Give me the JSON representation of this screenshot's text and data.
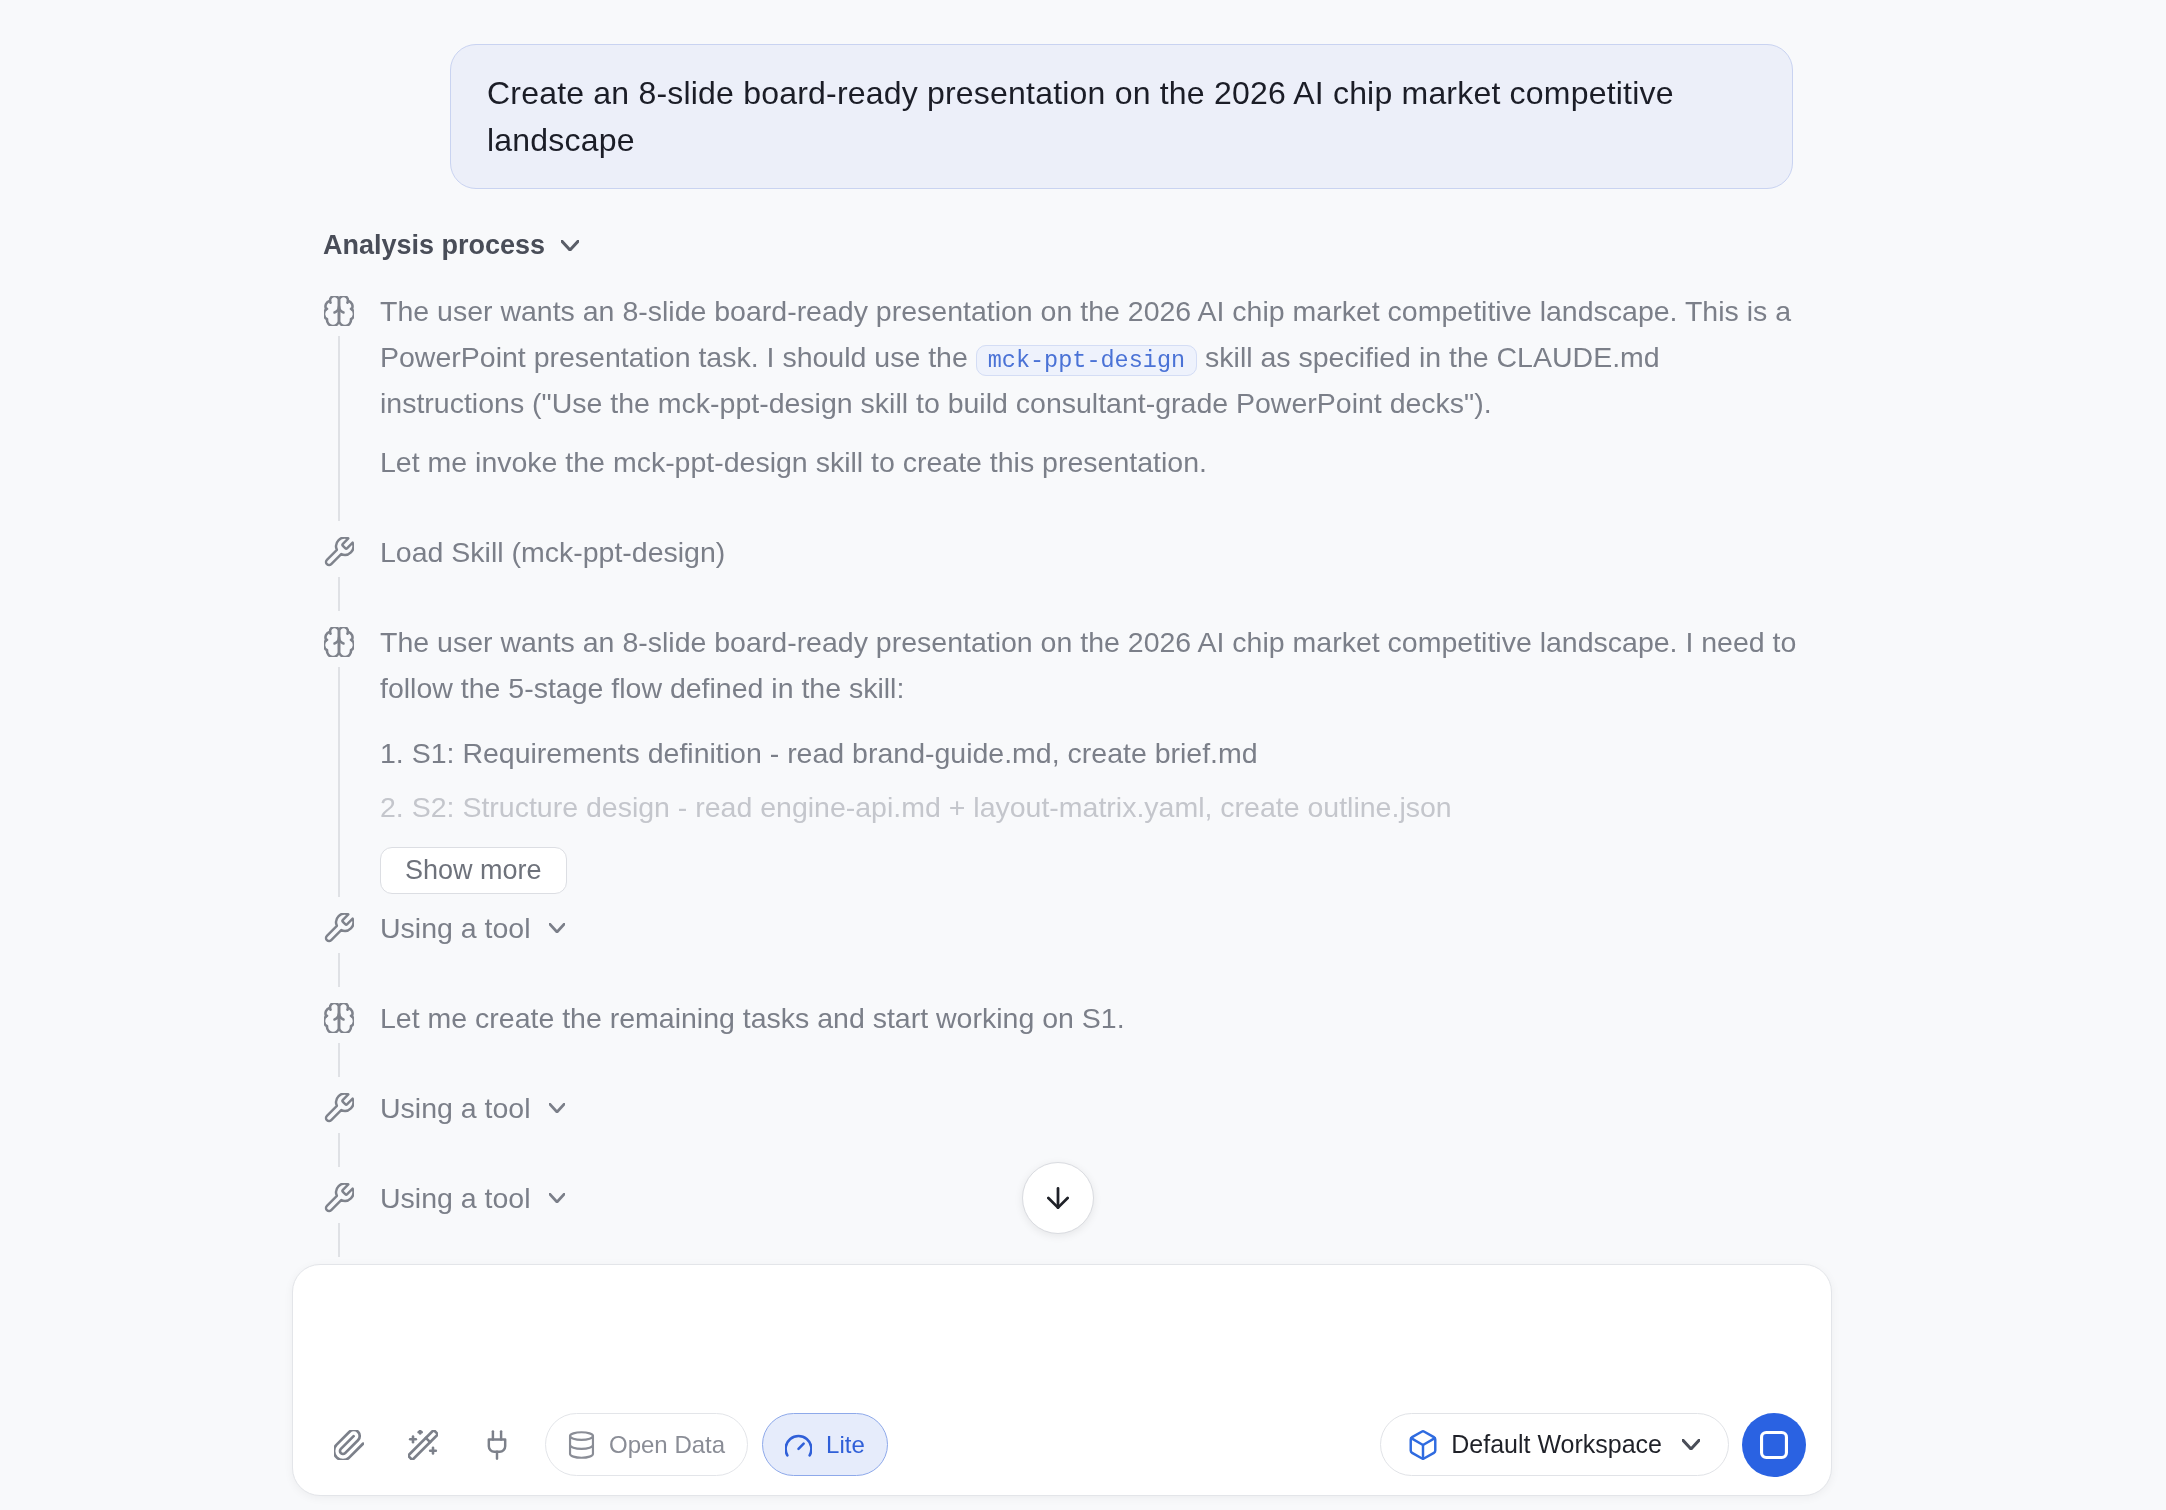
{
  "user_message": {
    "text": "Create an 8-slide board-ready presentation on the 2026 AI chip market competitive landscape"
  },
  "analysis": {
    "title": "Analysis process",
    "expanded": true,
    "steps": [
      {
        "kind": "thought",
        "paragraphs": [
          {
            "parts": [
              {
                "kind": "text",
                "text": "The user wants an 8-slide board-ready presentation on the 2026 AI chip market competitive landscape. This is a PowerPoint presentation task. I should use the "
              },
              {
                "kind": "code",
                "text": "mck-ppt-design"
              },
              {
                "kind": "text",
                "text": " skill as specified in the CLAUDE.md instructions (\"Use the mck-ppt-design skill to build consultant-grade PowerPoint decks\")."
              }
            ]
          },
          {
            "parts": [
              {
                "kind": "text",
                "text": "Let me invoke the mck-ppt-design skill to create this presentation."
              }
            ]
          }
        ]
      },
      {
        "kind": "tool",
        "label": "Load Skill (mck-ppt-design)",
        "collapsible": false
      },
      {
        "kind": "thought",
        "paragraphs": [
          {
            "parts": [
              {
                "kind": "text",
                "text": "The user wants an 8-slide board-ready presentation on the 2026 AI chip market competitive landscape. I need to follow the 5-stage flow defined in the skill:"
              }
            ]
          }
        ],
        "items": [
          "1. S1: Requirements definition - read brand-guide.md, create brief.md",
          "2. S2: Structure design - read engine-api.md + layout-matrix.yaml, create outline.json"
        ],
        "collapsed": true,
        "show_more": "Show more"
      },
      {
        "kind": "tool",
        "label": "Using a tool",
        "collapsible": true
      },
      {
        "kind": "thought",
        "paragraphs": [
          {
            "parts": [
              {
                "kind": "text",
                "text": "Let me create the remaining tasks and start working on S1."
              }
            ]
          }
        ]
      },
      {
        "kind": "tool",
        "label": "Using a tool",
        "collapsible": true
      },
      {
        "kind": "tool",
        "label": "Using a tool",
        "collapsible": true
      }
    ]
  },
  "composer": {
    "open_data": {
      "label": "Open Data",
      "selected": false
    },
    "lite": {
      "label": "Lite",
      "selected": true
    },
    "workspace": {
      "label": "Default Workspace"
    }
  }
}
